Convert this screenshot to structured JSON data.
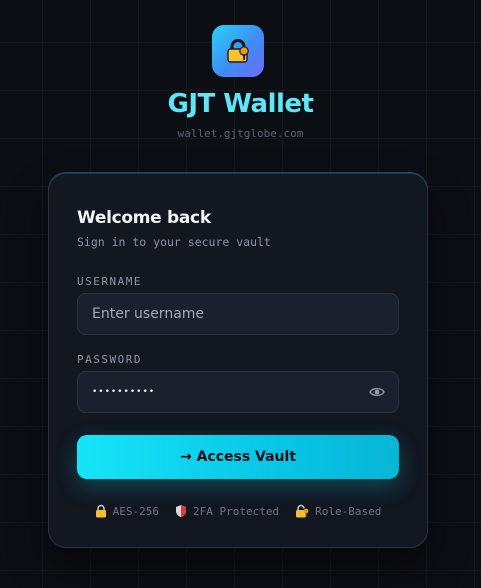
{
  "app": {
    "title": "GJT Wallet",
    "domain": "wallet.gjtglobe.com",
    "logo_icon": "lock-key-icon"
  },
  "login": {
    "heading": "Welcome back",
    "subheading": "Sign in to your secure vault",
    "username": {
      "label": "USERNAME",
      "placeholder": "Enter username",
      "value": ""
    },
    "password": {
      "label": "PASSWORD",
      "value": "••••••••••",
      "toggle_icon": "eye-icon"
    },
    "submit_label": "→ Access Vault"
  },
  "badges": [
    {
      "icon": "lock-icon",
      "label": "AES-256"
    },
    {
      "icon": "shield-icon",
      "label": "2FA Protected"
    },
    {
      "icon": "lock-key-icon",
      "label": "Role-Based"
    }
  ],
  "colors": {
    "accent": "#16e5f7",
    "title": "#5ee6f7",
    "background": "#0b0e13",
    "card": "#121720"
  }
}
